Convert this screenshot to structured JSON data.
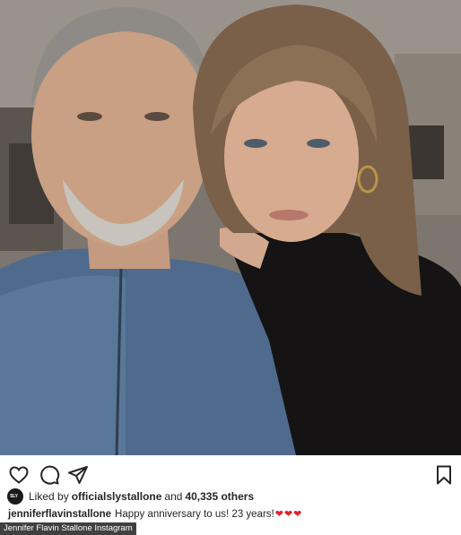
{
  "post": {
    "image_alt": "Selfie of a couple",
    "actions": {
      "like_icon": "heart-outline-icon",
      "comment_icon": "comment-bubble-icon",
      "share_icon": "paper-plane-icon",
      "save_icon": "bookmark-icon"
    },
    "likes": {
      "badge_text": "SLY",
      "prefix": "Liked by",
      "liker": "officialslystallone",
      "connector": "and",
      "count": "40,335 others"
    },
    "caption": {
      "username": "jenniferflavinstallone",
      "text": "Happy anniversary to us! 23 years!",
      "emoji": [
        "❤",
        "❤",
        "❤"
      ]
    }
  },
  "credit": "Jennifer Flavin Stallone Instagram",
  "colors": {
    "heart": "#e0242c",
    "text": "#262626",
    "background": "#ffffff"
  }
}
